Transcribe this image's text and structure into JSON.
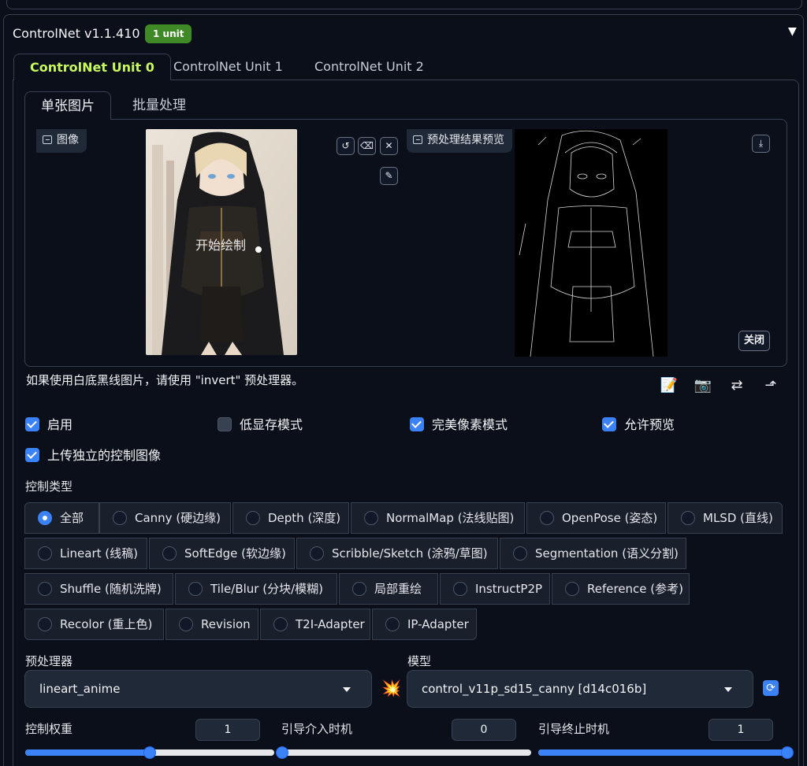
{
  "header": {
    "title": "ControlNet v1.1.410",
    "badge": "1 unit",
    "collapse_icon": "▼"
  },
  "unit_tabs": [
    "ControlNet Unit 0",
    "ControlNet Unit 1",
    "ControlNet Unit 2"
  ],
  "sub_tabs": [
    "单张图片",
    "批量处理"
  ],
  "image_panel": {
    "label": "图像",
    "overlay_text": "开始绘制"
  },
  "preview_panel": {
    "label": "预处理结果预览",
    "close_label": "关闭"
  },
  "hint": "如果使用白底黑线图片，请使用 \"invert\" 预处理器。",
  "checkboxes": [
    {
      "label": "启用",
      "checked": true
    },
    {
      "label": "低显存模式",
      "checked": false
    },
    {
      "label": "完美像素模式",
      "checked": true
    },
    {
      "label": "允许预览",
      "checked": true
    },
    {
      "label": "上传独立的控制图像",
      "checked": true
    }
  ],
  "control_type": {
    "label": "控制类型",
    "selected": "全部",
    "options": [
      "全部",
      "Canny (硬边缘)",
      "Depth (深度)",
      "NormalMap (法线贴图)",
      "OpenPose (姿态)",
      "MLSD (直线)",
      "Lineart (线稿)",
      "SoftEdge (软边缘)",
      "Scribble/Sketch (涂鸦/草图)",
      "Segmentation (语义分割)",
      "Shuffle (随机洗牌)",
      "Tile/Blur (分块/模糊)",
      "局部重绘",
      "InstructP2P",
      "Reference (参考)",
      "Recolor (重上色)",
      "Revision",
      "T2I-Adapter",
      "IP-Adapter"
    ]
  },
  "preprocessor": {
    "label": "预处理器",
    "value": "lineart_anime"
  },
  "model": {
    "label": "模型",
    "value": "control_v11p_sd15_canny [d14c016b]"
  },
  "sliders": [
    {
      "label": "控制权重",
      "value": "1",
      "fraction": 0.5
    },
    {
      "label": "引导介入时机",
      "value": "0",
      "fraction": 0.0
    },
    {
      "label": "引导终止时机",
      "value": "1",
      "fraction": 1.0
    }
  ],
  "colors": {
    "accent": "#3b82f6",
    "active_tab": "#c7f95f",
    "badge": "#3f8a26",
    "background": "#0b0f19"
  }
}
